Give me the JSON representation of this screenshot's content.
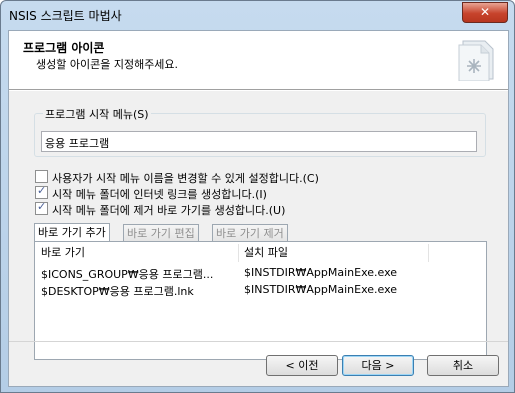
{
  "window": {
    "title": "NSIS 스크립트 마법사",
    "close_label": "✕"
  },
  "header": {
    "title": "프로그램 아이콘",
    "subtitle": "생성할 아이콘을 지정해주세요.",
    "icon": "document-gear-icon"
  },
  "start_menu": {
    "label": "프로그램 시작 메뉴(S)",
    "value": "응용 프로그램"
  },
  "options": [
    {
      "label": "사용자가 시작 메뉴 이름을 변경할 수 있게 설정합니다.(C)",
      "checked": false
    },
    {
      "label": "시작 메뉴 폴더에 인터넷 링크를 생성합니다.(I)",
      "checked": true
    },
    {
      "label": "시작 메뉴 폴더에 제거 바로 가기를 생성합니다.(U)",
      "checked": true
    }
  ],
  "tabs": [
    "바로 가기 추가",
    "바로 가기 편집",
    "바로 가기 제거"
  ],
  "shortcuts": {
    "columns": [
      "바로 가기",
      "설치 파일"
    ],
    "rows": [
      [
        "$ICONS_GROUP₩응용 프로그램...",
        "$INSTDIR₩AppMainExe.exe"
      ],
      [
        "$DESKTOP₩응용 프로그램.lnk",
        "$INSTDIR₩AppMainExe.exe"
      ]
    ]
  },
  "buttons": {
    "back": "< 이전",
    "next": "다음 >",
    "cancel": "취소"
  }
}
